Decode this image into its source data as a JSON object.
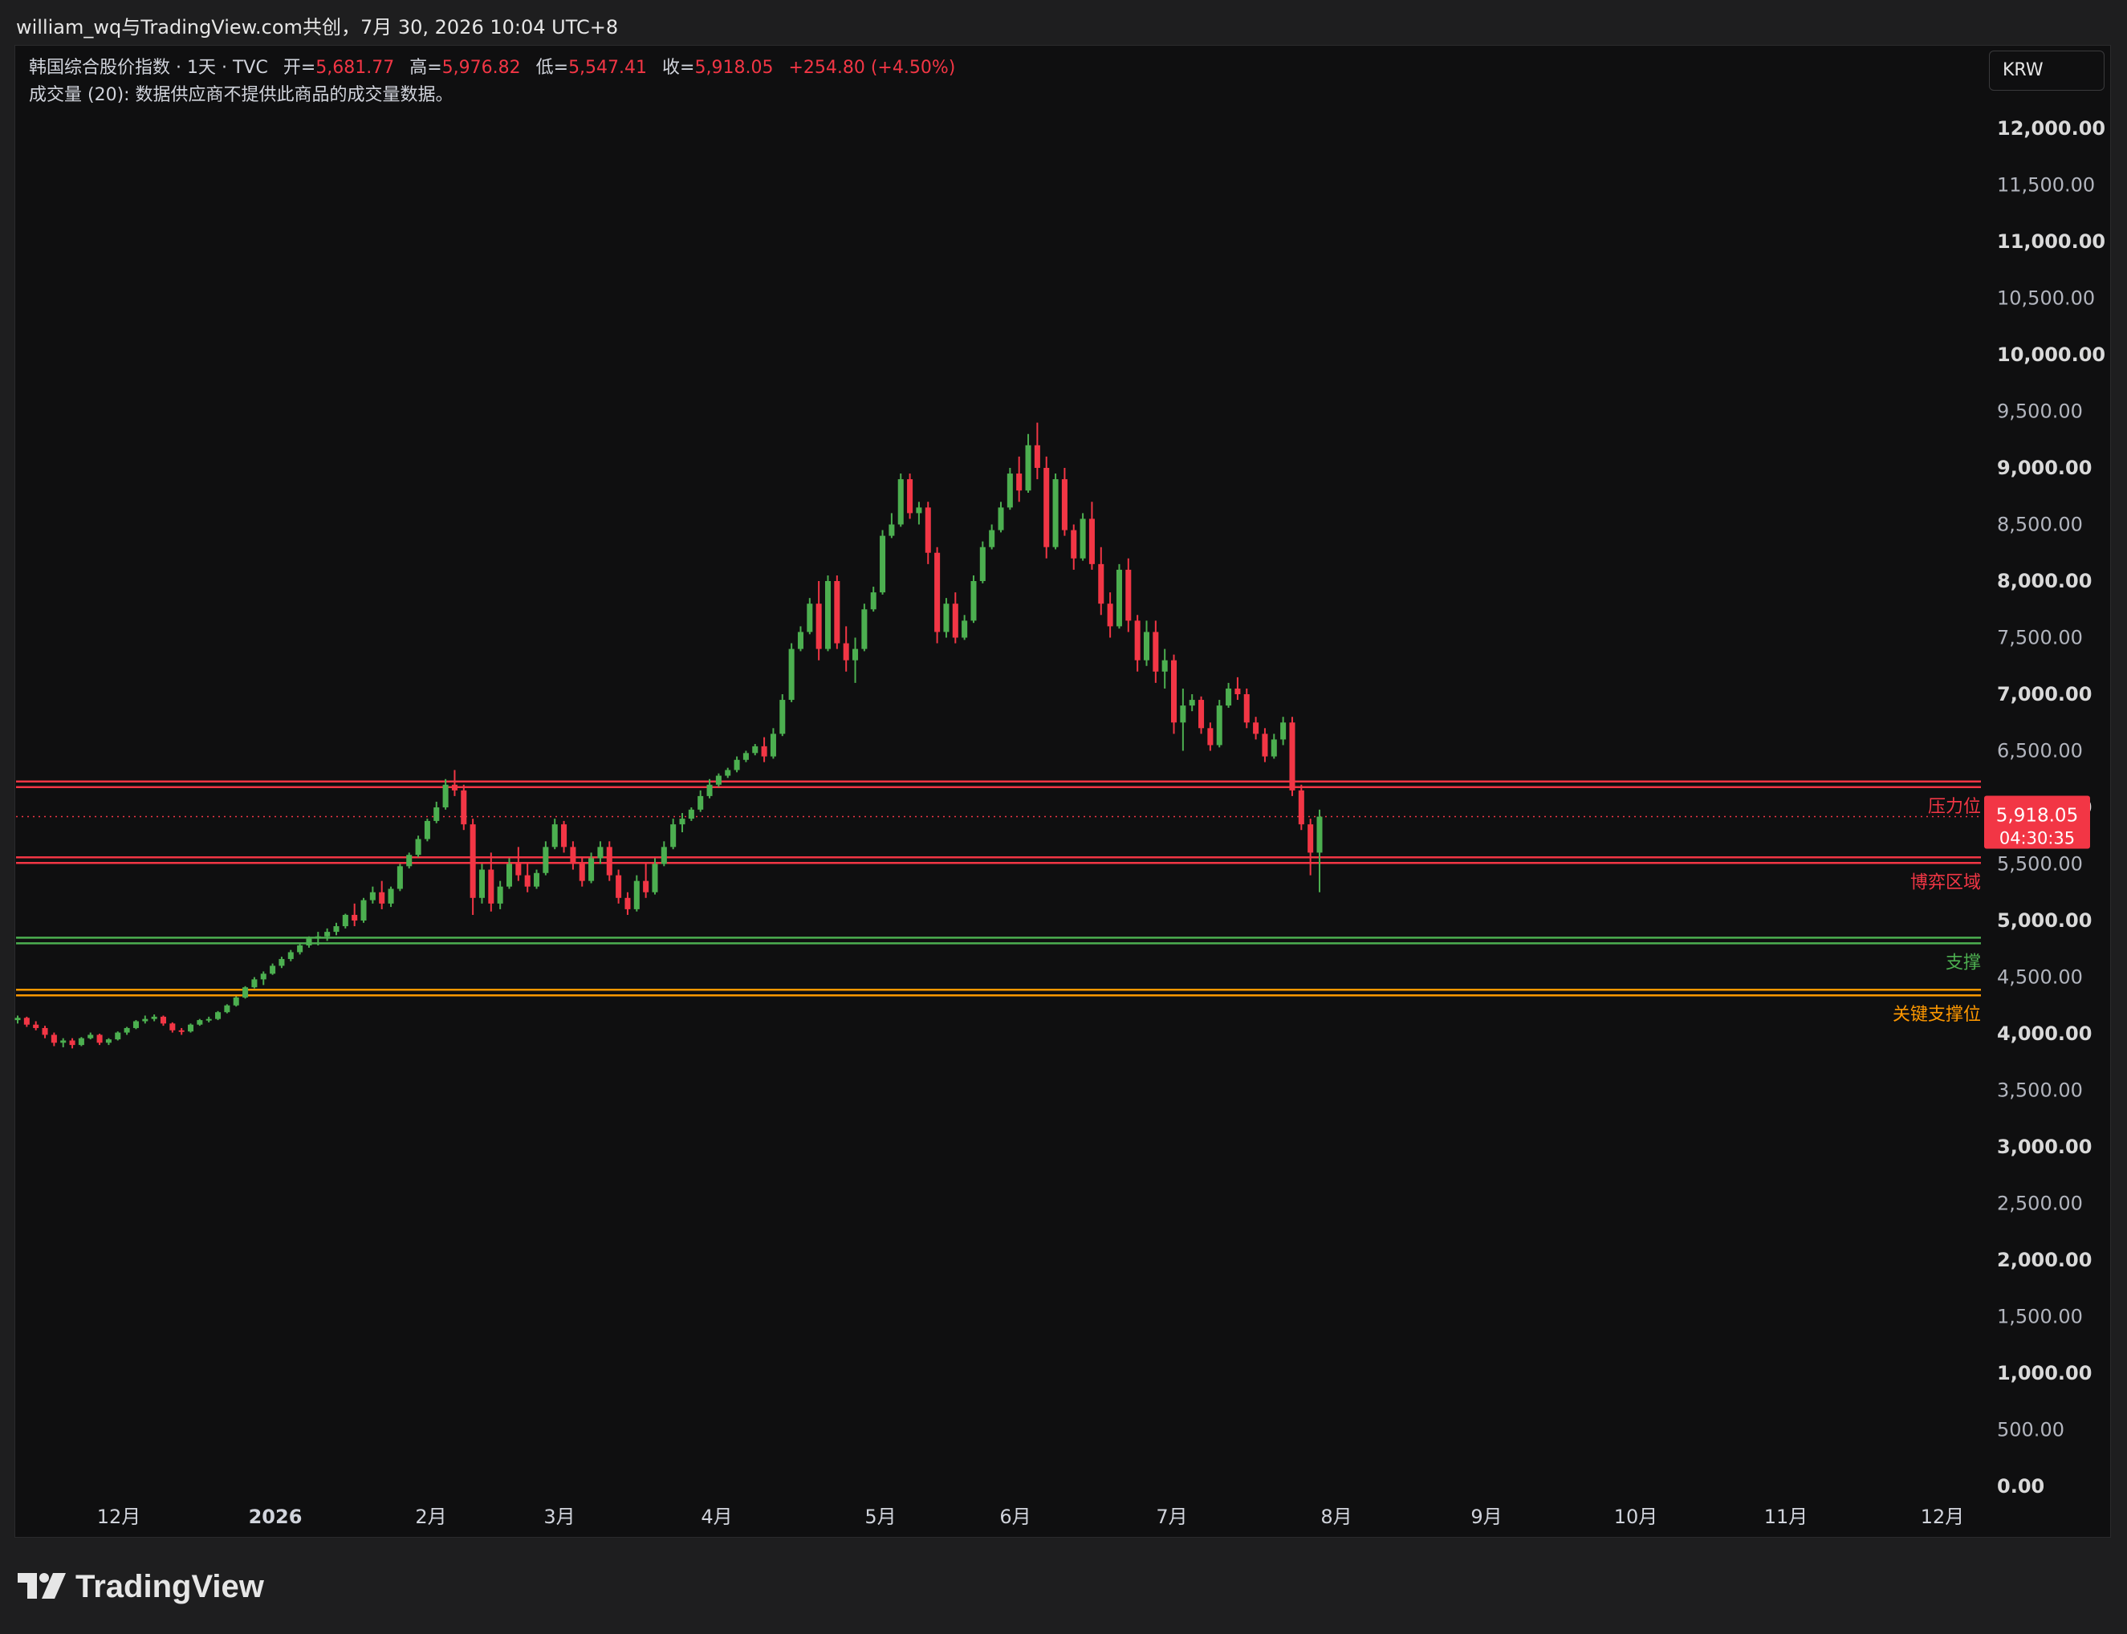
{
  "window": {
    "title": "william_wq与TradingView.com共创，7月 30, 2026 10:04 UTC+8"
  },
  "legend": {
    "symbol": "韩国综合股价指数 · 1天 · TVC",
    "open_label": "开=",
    "open": "5,681.77",
    "high_label": "高=",
    "high": "5,976.82",
    "low_label": "低=",
    "low": "5,547.41",
    "close_label": "收=",
    "close": "5,918.05",
    "change": "+254.80 (+4.50%)",
    "volume_text": "成交量 (20): 数据供应商不提供此商品的成交量数据。"
  },
  "currency": "KRW",
  "branding": {
    "name": "TradingView"
  },
  "colors": {
    "up": "#4caf50",
    "down": "#f23645",
    "resistance": "#f23645",
    "support": "#4caf50",
    "key_support": "#ff9800",
    "background": "#0f0f10"
  },
  "price_badge": {
    "price": "5,918.05",
    "countdown": "04:30:35"
  },
  "chart_data": {
    "type": "candlestick",
    "y_axis": {
      "ylim": [
        0,
        12000
      ],
      "ticks": [
        "12,000.00",
        "11,500.00",
        "11,000.00",
        "10,500.00",
        "10,000.00",
        "9,500.00",
        "9,000.00",
        "8,500.00",
        "8,000.00",
        "7,500.00",
        "7,000.00",
        "6,500.00",
        "6,000.00",
        "5,500.00",
        "5,000.00",
        "4,500.00",
        "4,000.00",
        "3,500.00",
        "3,000.00",
        "2,500.00",
        "2,000.00",
        "1,500.00",
        "1,000.00",
        "500.00",
        "0.00"
      ]
    },
    "x_axis": {
      "ticks": [
        "12月",
        "2026",
        "2月",
        "3月",
        "4月",
        "5月",
        "6月",
        "7月",
        "8月",
        "9月",
        "10月",
        "11月",
        "12月"
      ]
    },
    "levels": [
      {
        "label": "压力位",
        "price": 6200,
        "kind": "resistance"
      },
      {
        "label": "博弈区域",
        "price": 5530,
        "kind": "resistance"
      },
      {
        "label": "支撑",
        "price": 4820,
        "kind": "support"
      },
      {
        "label": "关键支撑位",
        "price": 4360,
        "kind": "key_support"
      }
    ],
    "last_price": 5918.05,
    "candles_ohlc": [
      [
        4120,
        4160,
        4090,
        4140
      ],
      [
        4140,
        4150,
        4060,
        4080
      ],
      [
        4080,
        4110,
        4030,
        4050
      ],
      [
        4050,
        4070,
        3960,
        3990
      ],
      [
        3990,
        4010,
        3890,
        3920
      ],
      [
        3920,
        3960,
        3880,
        3940
      ],
      [
        3940,
        3960,
        3870,
        3900
      ],
      [
        3900,
        3970,
        3890,
        3960
      ],
      [
        3960,
        4010,
        3950,
        3990
      ],
      [
        3990,
        4000,
        3900,
        3920
      ],
      [
        3920,
        3960,
        3900,
        3950
      ],
      [
        3950,
        4020,
        3940,
        4010
      ],
      [
        4010,
        4060,
        3990,
        4050
      ],
      [
        4050,
        4120,
        4040,
        4110
      ],
      [
        4110,
        4160,
        4090,
        4130
      ],
      [
        4130,
        4170,
        4110,
        4150
      ],
      [
        4150,
        4160,
        4070,
        4090
      ],
      [
        4090,
        4100,
        4010,
        4030
      ],
      [
        4030,
        4050,
        3990,
        4020
      ],
      [
        4020,
        4090,
        4010,
        4080
      ],
      [
        4080,
        4130,
        4070,
        4120
      ],
      [
        4120,
        4150,
        4100,
        4130
      ],
      [
        4130,
        4200,
        4120,
        4190
      ],
      [
        4190,
        4260,
        4180,
        4250
      ],
      [
        4250,
        4330,
        4240,
        4320
      ],
      [
        4320,
        4420,
        4310,
        4410
      ],
      [
        4410,
        4500,
        4400,
        4480
      ],
      [
        4480,
        4550,
        4430,
        4530
      ],
      [
        4530,
        4620,
        4520,
        4600
      ],
      [
        4600,
        4680,
        4580,
        4660
      ],
      [
        4660,
        4740,
        4640,
        4720
      ],
      [
        4720,
        4800,
        4700,
        4780
      ],
      [
        4780,
        4860,
        4760,
        4840
      ],
      [
        4840,
        4900,
        4780,
        4860
      ],
      [
        4860,
        4930,
        4820,
        4900
      ],
      [
        4900,
        4980,
        4870,
        4950
      ],
      [
        4950,
        5060,
        4930,
        5050
      ],
      [
        5050,
        5150,
        4950,
        5000
      ],
      [
        5000,
        5200,
        4980,
        5180
      ],
      [
        5180,
        5300,
        5150,
        5250
      ],
      [
        5250,
        5350,
        5100,
        5150
      ],
      [
        5150,
        5300,
        5120,
        5280
      ],
      [
        5280,
        5500,
        5260,
        5480
      ],
      [
        5480,
        5600,
        5460,
        5580
      ],
      [
        5580,
        5750,
        5560,
        5720
      ],
      [
        5720,
        5900,
        5700,
        5880
      ],
      [
        5880,
        6050,
        5860,
        6000
      ],
      [
        6000,
        6250,
        5980,
        6200
      ],
      [
        6200,
        6330,
        6100,
        6150
      ],
      [
        6150,
        6200,
        5800,
        5850
      ],
      [
        5850,
        5900,
        5050,
        5200
      ],
      [
        5200,
        5500,
        5150,
        5450
      ],
      [
        5450,
        5600,
        5080,
        5150
      ],
      [
        5150,
        5350,
        5100,
        5300
      ],
      [
        5300,
        5550,
        5280,
        5500
      ],
      [
        5500,
        5650,
        5350,
        5400
      ],
      [
        5400,
        5500,
        5250,
        5300
      ],
      [
        5300,
        5450,
        5280,
        5420
      ],
      [
        5420,
        5700,
        5400,
        5650
      ],
      [
        5650,
        5900,
        5630,
        5850
      ],
      [
        5850,
        5880,
        5600,
        5650
      ],
      [
        5650,
        5700,
        5450,
        5500
      ],
      [
        5500,
        5550,
        5300,
        5350
      ],
      [
        5350,
        5600,
        5330,
        5550
      ],
      [
        5550,
        5700,
        5500,
        5650
      ],
      [
        5650,
        5700,
        5350,
        5400
      ],
      [
        5400,
        5450,
        5150,
        5200
      ],
      [
        5200,
        5250,
        5050,
        5100
      ],
      [
        5100,
        5400,
        5080,
        5350
      ],
      [
        5350,
        5500,
        5200,
        5250
      ],
      [
        5250,
        5550,
        5230,
        5500
      ],
      [
        5500,
        5700,
        5480,
        5650
      ],
      [
        5650,
        5900,
        5630,
        5850
      ],
      [
        5850,
        5950,
        5780,
        5900
      ],
      [
        5900,
        6000,
        5880,
        5980
      ],
      [
        5980,
        6150,
        5960,
        6100
      ],
      [
        6100,
        6250,
        6080,
        6200
      ],
      [
        6200,
        6300,
        6180,
        6280
      ],
      [
        6280,
        6350,
        6260,
        6330
      ],
      [
        6330,
        6450,
        6310,
        6420
      ],
      [
        6420,
        6500,
        6400,
        6480
      ],
      [
        6480,
        6560,
        6460,
        6540
      ],
      [
        6540,
        6620,
        6400,
        6450
      ],
      [
        6450,
        6700,
        6430,
        6650
      ],
      [
        6650,
        7000,
        6630,
        6950
      ],
      [
        6950,
        7450,
        6930,
        7400
      ],
      [
        7400,
        7600,
        7380,
        7550
      ],
      [
        7550,
        7850,
        7530,
        7800
      ],
      [
        7800,
        8000,
        7300,
        7400
      ],
      [
        7400,
        8050,
        7380,
        8000
      ],
      [
        8000,
        8050,
        7400,
        7450
      ],
      [
        7450,
        7600,
        7200,
        7300
      ],
      [
        7300,
        7500,
        7100,
        7400
      ],
      [
        7400,
        7800,
        7380,
        7750
      ],
      [
        7750,
        7950,
        7730,
        7900
      ],
      [
        7900,
        8450,
        7880,
        8400
      ],
      [
        8400,
        8600,
        8380,
        8500
      ],
      [
        8500,
        8950,
        8480,
        8900
      ],
      [
        8900,
        8950,
        8550,
        8600
      ],
      [
        8600,
        8700,
        8500,
        8650
      ],
      [
        8650,
        8700,
        8150,
        8250
      ],
      [
        8250,
        8300,
        7450,
        7550
      ],
      [
        7550,
        7850,
        7500,
        7800
      ],
      [
        7800,
        7900,
        7450,
        7500
      ],
      [
        7500,
        7700,
        7480,
        7650
      ],
      [
        7650,
        8050,
        7630,
        8000
      ],
      [
        8000,
        8350,
        7980,
        8300
      ],
      [
        8300,
        8500,
        8280,
        8450
      ],
      [
        8450,
        8700,
        8430,
        8650
      ],
      [
        8650,
        9000,
        8630,
        8950
      ],
      [
        8950,
        9100,
        8700,
        8800
      ],
      [
        8800,
        9300,
        8780,
        9200
      ],
      [
        9200,
        9400,
        8900,
        9000
      ],
      [
        9000,
        9100,
        8200,
        8300
      ],
      [
        8300,
        8950,
        8280,
        8900
      ],
      [
        8900,
        9000,
        8400,
        8450
      ],
      [
        8450,
        8500,
        8100,
        8200
      ],
      [
        8200,
        8600,
        8180,
        8550
      ],
      [
        8550,
        8700,
        8100,
        8150
      ],
      [
        8150,
        8300,
        7700,
        7800
      ],
      [
        7800,
        7900,
        7500,
        7600
      ],
      [
        7600,
        8150,
        7580,
        8100
      ],
      [
        8100,
        8200,
        7550,
        7650
      ],
      [
        7650,
        7700,
        7200,
        7300
      ],
      [
        7300,
        7650,
        7250,
        7550
      ],
      [
        7550,
        7650,
        7100,
        7200
      ],
      [
        7200,
        7400,
        7050,
        7300
      ],
      [
        7300,
        7350,
        6650,
        6750
      ],
      [
        6750,
        7050,
        6500,
        6900
      ],
      [
        6900,
        7000,
        6850,
        6950
      ],
      [
        6950,
        6980,
        6650,
        6700
      ],
      [
        6700,
        6750,
        6500,
        6550
      ],
      [
        6550,
        6950,
        6530,
        6900
      ],
      [
        6900,
        7100,
        6880,
        7050
      ],
      [
        7050,
        7150,
        6950,
        7000
      ],
      [
        7000,
        7050,
        6700,
        6750
      ],
      [
        6750,
        6800,
        6600,
        6650
      ],
      [
        6650,
        6700,
        6400,
        6450
      ],
      [
        6450,
        6650,
        6430,
        6600
      ],
      [
        6600,
        6800,
        6550,
        6750
      ],
      [
        6750,
        6800,
        6100,
        6150
      ],
      [
        6150,
        6200,
        5800,
        5850
      ],
      [
        5850,
        5900,
        5400,
        5600
      ],
      [
        5600,
        5980,
        5250,
        5918
      ]
    ]
  }
}
